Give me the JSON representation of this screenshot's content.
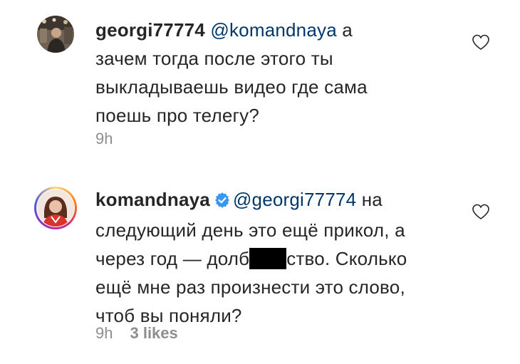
{
  "comments": [
    {
      "username": "georgi77774",
      "mention": "@komandnaya",
      "line1_tail": " а",
      "line2": "зачем тогда после этого ты",
      "line3": "выкладываешь видео где сама",
      "line4": "поешь про телегу?",
      "time": "9h"
    },
    {
      "username": "komandnaya",
      "mention": "@georgi77774",
      "line1_tail": " на",
      "line2": "следующий день это ещё прикол, а",
      "line3_a": "через год — долб",
      "line3_b": "ство. Сколько",
      "line4": "ещё мне раз произнести это слово,",
      "line5": "чтоб вы поняли?",
      "time": "9h",
      "likes": "3 likes"
    }
  ],
  "colors": {
    "text": "#262626",
    "mention": "#00376b",
    "meta": "#8e8e8e",
    "verified": "#3897f0"
  },
  "icons": {
    "like": "heart-outline-icon",
    "verified": "verified-badge-icon"
  }
}
